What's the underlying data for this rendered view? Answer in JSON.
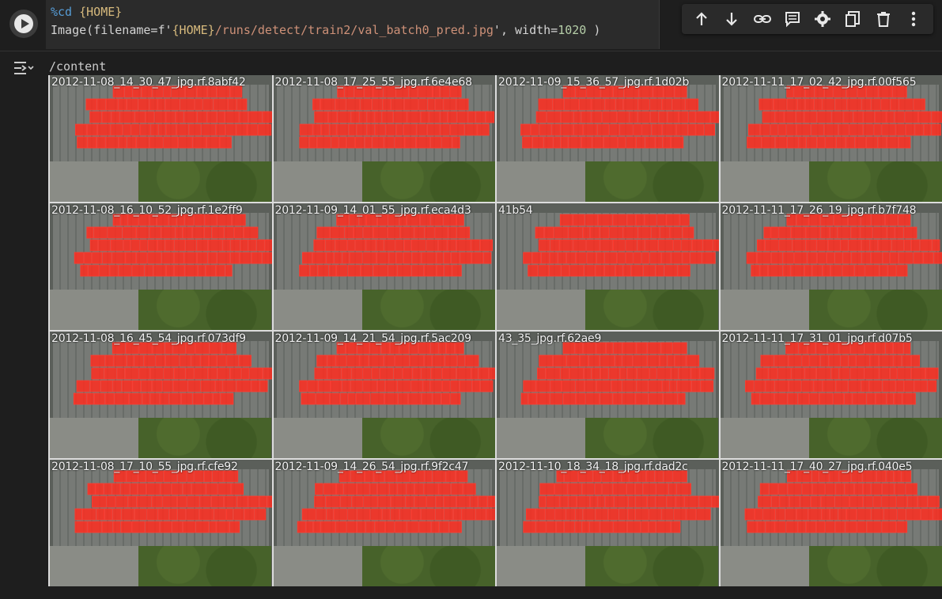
{
  "cell": {
    "code_lines": [
      {
        "parts": [
          {
            "cls": "magic",
            "t": "%cd "
          },
          {
            "cls": "var",
            "t": "{HOME}"
          }
        ]
      },
      {
        "parts": [
          {
            "cls": "",
            "t": "Image(filename=f'"
          },
          {
            "cls": "var",
            "t": "{HOME}"
          },
          {
            "cls": "str",
            "t": "/runs/detect/train2/val_batch0_pred.jpg"
          },
          {
            "cls": "",
            "t": "', width="
          },
          {
            "cls": "num",
            "t": "1020"
          },
          {
            "cls": "",
            "t": " )"
          }
        ]
      }
    ]
  },
  "toolbar": {
    "icons": [
      "move-up-icon",
      "move-down-icon",
      "link-icon",
      "comment-icon",
      "settings-icon",
      "mirror-cell-icon",
      "delete-icon",
      "more-icon"
    ]
  },
  "output": {
    "text": "/content",
    "tiles": [
      {
        "label": "2012-11-08_14_30_47_jpg.rf.8abf42"
      },
      {
        "label": "2012-11-08_17_25_55_jpg.rf.6e4e68"
      },
      {
        "label": "2012-11-09_15_36_57_jpg.rf.1d02b"
      },
      {
        "label": "2012-11-11_17_02_42_jpg.rf.00f565"
      },
      {
        "label": "2012-11-08_16_10_52_jpg.rf.1e2ff9"
      },
      {
        "label": "2012-11-09_14_01_55_jpg.rf.eca4d3"
      },
      {
        "label": "41b54"
      },
      {
        "label": "2012-11-11_17_26_19_jpg.rf.b7f748"
      },
      {
        "label": "2012-11-08_16_45_54_jpg.rf.073df9"
      },
      {
        "label": "2012-11-09_14_21_54_jpg.rf.5ac209"
      },
      {
        "label": "43_35_jpg.rf.62ae9"
      },
      {
        "label": "2012-11-11_17_31_01_jpg.rf.d07b5"
      },
      {
        "label": "2012-11-08_17_10_55_jpg.rf.cfe92"
      },
      {
        "label": "2012-11-09_14_26_54_jpg.rf.9f2c47"
      },
      {
        "label": "2012-11-10_18_34_18_jpg.rf.dad2c"
      },
      {
        "label": "2012-11-11_17_40_27_jpg.rf.040e5"
      }
    ]
  },
  "colors": {
    "box": "#ff3b30",
    "label_bg": "#ff2d20"
  }
}
